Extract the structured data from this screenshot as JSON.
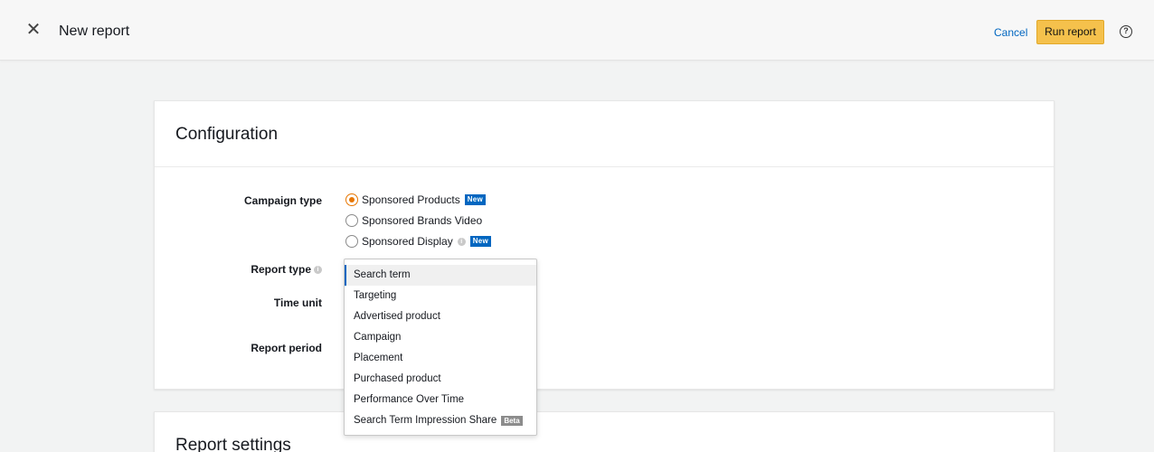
{
  "header": {
    "close_glyph": "✕",
    "title": "New report",
    "cancel_label": "Cancel",
    "run_label": "Run report",
    "help_glyph": "?"
  },
  "configuration": {
    "title": "Configuration",
    "campaign_type_label": "Campaign type",
    "campaign_types": [
      {
        "label": "Sponsored Products",
        "badge": "New",
        "selected": true
      },
      {
        "label": "Sponsored Brands Video",
        "badge": "",
        "selected": false
      },
      {
        "label": "Sponsored Display",
        "badge": "New",
        "selected": false,
        "info": true
      }
    ],
    "report_type_label": "Report type",
    "time_unit_label": "Time unit",
    "report_period_label": "Report period"
  },
  "report_type_dropdown": {
    "options": [
      {
        "label": "Search term",
        "selected": true
      },
      {
        "label": "Targeting"
      },
      {
        "label": "Advertised product"
      },
      {
        "label": "Campaign"
      },
      {
        "label": "Placement"
      },
      {
        "label": "Purchased product"
      },
      {
        "label": "Performance Over Time"
      },
      {
        "label": "Search Term Impression Share",
        "badge": "Beta"
      }
    ]
  },
  "delivery": {
    "title": "Report settings"
  },
  "colors": {
    "accent_button": "#f5c14c",
    "link": "#0066c0",
    "radio_selected": "#e77600",
    "badge_new": "#0066c0",
    "badge_beta": "#8c8c8c"
  }
}
